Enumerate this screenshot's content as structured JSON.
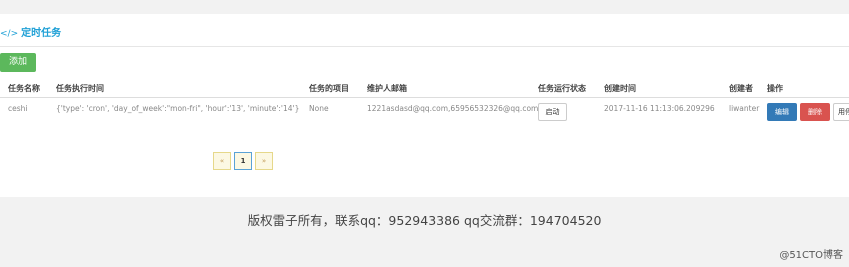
{
  "panel": {
    "title_icon": "</>",
    "title": "定时任务"
  },
  "toolbar": {
    "add_label": "添加"
  },
  "table": {
    "headers": [
      "任务名称",
      "任务执行时间",
      "任务的项目",
      "维护人邮箱",
      "任务运行状态",
      "创建时间",
      "创建者",
      "操作"
    ],
    "rows": [
      {
        "name": "ceshi",
        "schedule": "{'type': 'cron', 'day_of_week':\"mon-fri\", 'hour':'13', 'minute':'14'}",
        "project": "None",
        "emails": "1221asdasd@qq.com,659565323​26@qq.com",
        "status_button": "启动",
        "created_at": "2017-11-16 11:13:06.209296",
        "creator": "liwanter",
        "actions": {
          "edit": "编辑",
          "delete": "删除",
          "disable": "用停"
        }
      }
    ]
  },
  "pagination": {
    "prev": "«",
    "current": "1",
    "next": "»"
  },
  "footer": {
    "text": "版权雷子所有，联系qq：952943386 qq交流群：194704520"
  },
  "watermark": "@51CTO博客",
  "colors": {
    "accent": "#1fa0d6",
    "add": "#5cb85c",
    "edit": "#337ab7",
    "delete": "#d9534f"
  }
}
